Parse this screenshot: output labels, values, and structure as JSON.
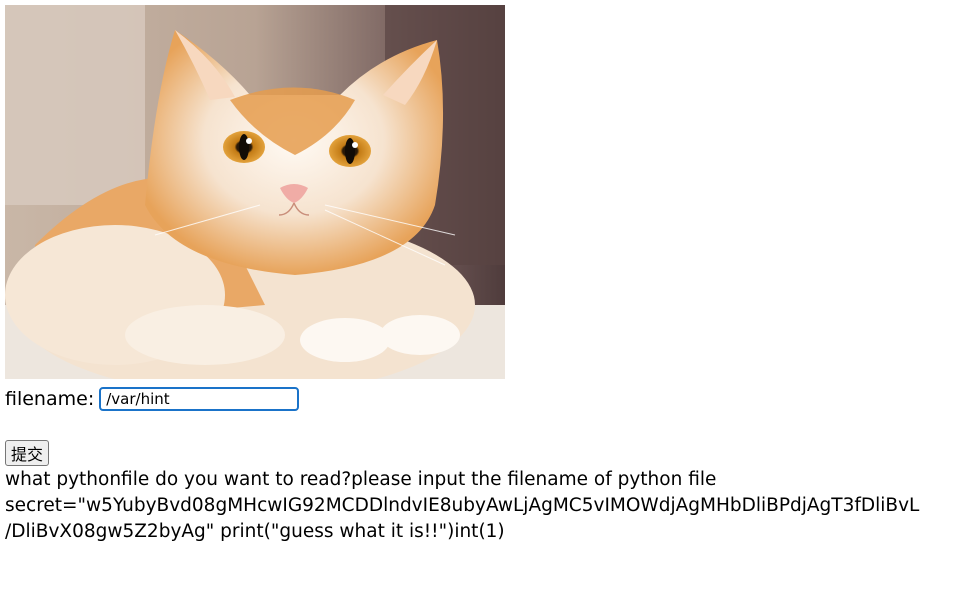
{
  "image": {
    "icon": "cat-photo",
    "colors": {
      "background": "#b9a592",
      "fur_orange": "#e8a55c",
      "fur_white": "#fbf3ea",
      "eye": "#d68a1f",
      "nose": "#f0b3ae"
    }
  },
  "form": {
    "filename_label": "filename:",
    "filename_value": "/var/hint",
    "submit_label": "提交"
  },
  "output": {
    "prompt": "what pythonfile do you want to read?please input the filename of python file",
    "secret_line": "secret=\"w5YubyBvd08gMHcwIG92MCDDlndvIE8ubyAwLjAgMC5vIMOWdjAgMHbDliBPdjAgT3fDliBvL",
    "secret_line2": "/DliBvX08gw5Z2byAg\" print(\"guess what it is!!\")int(1)"
  },
  "colors": {
    "input_border": "#1a73c9",
    "button_bg": "#efefef"
  }
}
